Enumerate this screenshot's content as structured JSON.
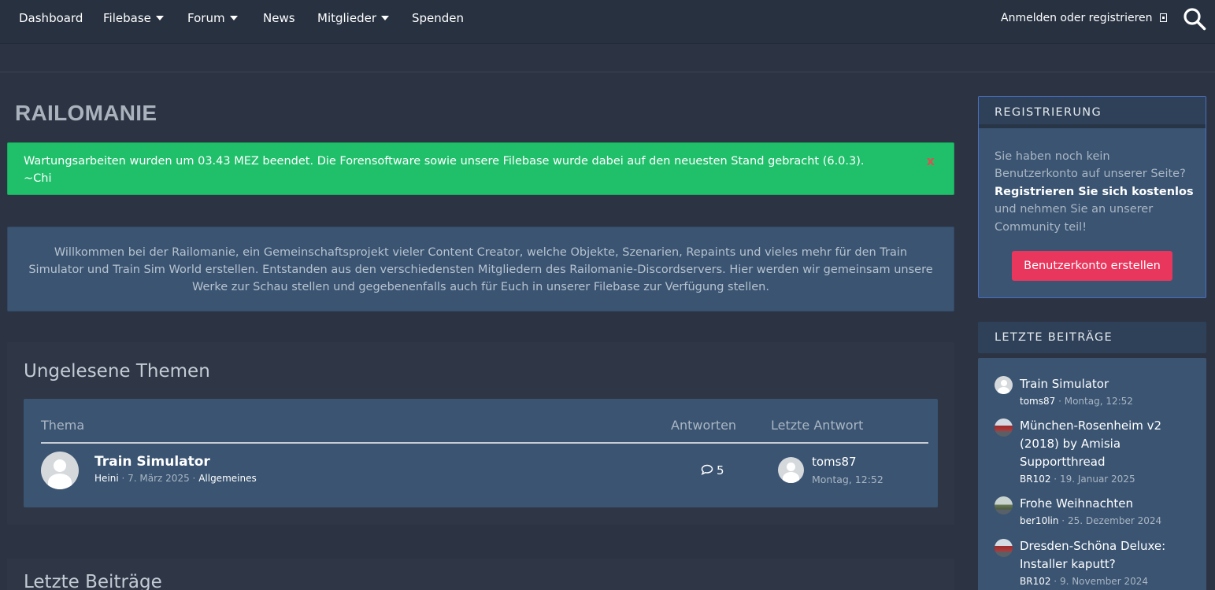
{
  "nav": {
    "items": [
      {
        "label": "Dashboard",
        "dropdown": false
      },
      {
        "label": "Filebase",
        "dropdown": true
      },
      {
        "label": "Forum",
        "dropdown": true
      },
      {
        "label": "News",
        "dropdown": false
      },
      {
        "label": "Mitglieder",
        "dropdown": true
      },
      {
        "label": "Spenden",
        "dropdown": false
      }
    ],
    "login_label": "Anmelden oder registrieren"
  },
  "site_title": "RAILOMANIE",
  "notice": {
    "line1": "Wartungsarbeiten wurden um 03.43 MEZ beendet. Die Forensoftware sowie unsere Filebase wurde dabei auf den neuesten Stand gebracht (6.0.3).",
    "line2": "~Chi",
    "close": "x",
    "color": "#20c06b"
  },
  "welcome_text": "Willkommen bei der Railomanie, ein Gemeinschaftsprojekt vieler Content Creator, welche Objekte, Szenarien, Repaints und vieles mehr für den Train Simulator und Train Sim World erstellen. Entstanden aus den verschiedensten Mitgliedern des Railomanie-Discordservers. Hier werden wir gemeinsam unsere Werke zur Schau stellen und gegebenenfalls auch für Euch in unserer Filebase zur Verfügung stellen.",
  "unread": {
    "title": "Ungelesene Themen",
    "columns": {
      "topic": "Thema",
      "replies": "Antworten",
      "last": "Letzte Antwort"
    },
    "rows": [
      {
        "title": "Train Simulator",
        "author": "Heini",
        "date": "7. März 2025",
        "board": "Allgemeines",
        "replies": "5",
        "last_user": "toms87",
        "last_time": "Montag, 12:52"
      }
    ]
  },
  "latest_section_title": "Letzte Beiträge",
  "sidebar": {
    "registration": {
      "title": "REGISTRIERUNG",
      "text1": "Sie haben noch kein Benutzerkonto auf unserer Seite?",
      "bold": "Registrieren Sie sich kostenlos",
      "text2": "und nehmen Sie an unserer Community teil!",
      "button": "Benutzerkonto erstellen",
      "button_color": "#e8365d"
    },
    "latest_posts": {
      "title": "LETZTE BEITRÄGE",
      "items": [
        {
          "title": "Train Simulator",
          "user": "toms87",
          "time": "Montag, 12:52"
        },
        {
          "title": "München-Rosenheim v2 (2018) by Amisia Supportthread",
          "user": "BR102",
          "time": "19. Januar 2025"
        },
        {
          "title": "Frohe Weihnachten",
          "user": "ber10lin",
          "time": "25. Dezember 2024"
        },
        {
          "title": "Dresden-Schöna Deluxe: Installer kaputt?",
          "user": "BR102",
          "time": "9. November 2024"
        }
      ]
    }
  }
}
